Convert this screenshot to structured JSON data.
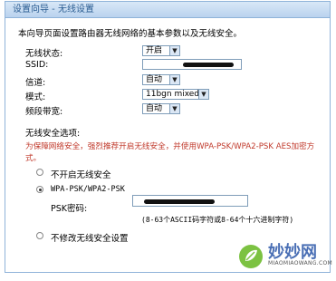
{
  "window": {
    "title": "设置向导 - 无线设置"
  },
  "intro": "本向导页面设置路由器无线网络的基本参数以及无线安全。",
  "fields": {
    "wireless_status": {
      "label": "无线状态:",
      "value": "开启"
    },
    "ssid": {
      "label": "SSID:"
    },
    "channel": {
      "label": "信道:",
      "value": "自动"
    },
    "mode": {
      "label": "模式:",
      "value": "11bgn mixed"
    },
    "bandwidth": {
      "label": "频段带宽:",
      "value": "自动"
    }
  },
  "security": {
    "title": "无线安全选项:",
    "warning_line1": "为保障网络安全，强烈推荐开启无线安全，并使用WPA-PSK/WPA2-PSK AES加密方",
    "warning_line2": "式。",
    "options": [
      {
        "label": "不开启无线安全",
        "selected": false
      },
      {
        "label": "WPA-PSK/WPA2-PSK",
        "selected": true
      },
      {
        "label": "不修改无线安全设置",
        "selected": false
      }
    ],
    "psk_label": "PSK密码:",
    "psk_hint": "(8-63个ASCII码字符或8-64个十六进制字符)"
  },
  "watermark": {
    "text": "妙妙网",
    "sub": "MIAOMIAOWANG.COM"
  }
}
